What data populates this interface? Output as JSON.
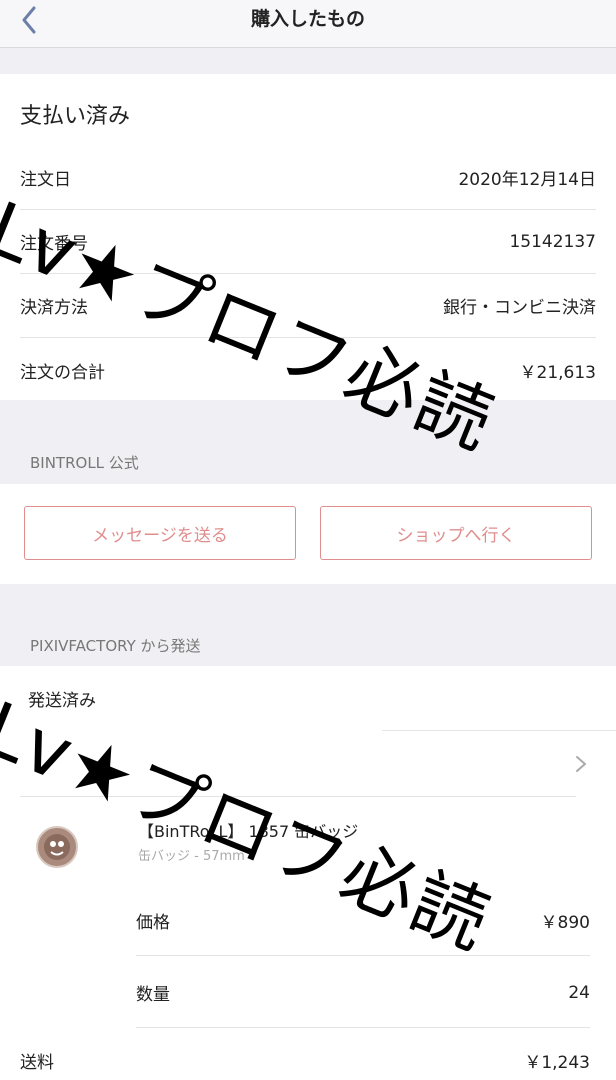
{
  "nav": {
    "title": "購入したもの"
  },
  "order": {
    "status": "支払い済み",
    "rows": [
      {
        "label": "注文日",
        "value": "2020年12月14日"
      },
      {
        "label": "注文番号",
        "value": "15142137"
      },
      {
        "label": "決済方法",
        "value": "銀行・コンビニ決済"
      },
      {
        "label": "注文の合計",
        "value": "￥21,613"
      }
    ]
  },
  "shop": {
    "name": "BINTROLL 公式",
    "message_button": "メッセージを送る",
    "shop_button": "ショップへ行く"
  },
  "shipping": {
    "from_label": "PIXIVFACTORY から発送",
    "status": "発送済み"
  },
  "item": {
    "title": "【BinTRoLL】 1857 缶バッジ",
    "variant": "缶バッジ - 57mm",
    "price_label": "価格",
    "price_value": "￥890",
    "qty_label": "数量",
    "qty_value": "24"
  },
  "postage": {
    "label": "送料",
    "value": "￥1,243"
  },
  "watermark": {
    "text": "Lv★プロフ必読"
  },
  "colors": {
    "accent": "#e08d8d",
    "background": "#f0f0f4"
  }
}
